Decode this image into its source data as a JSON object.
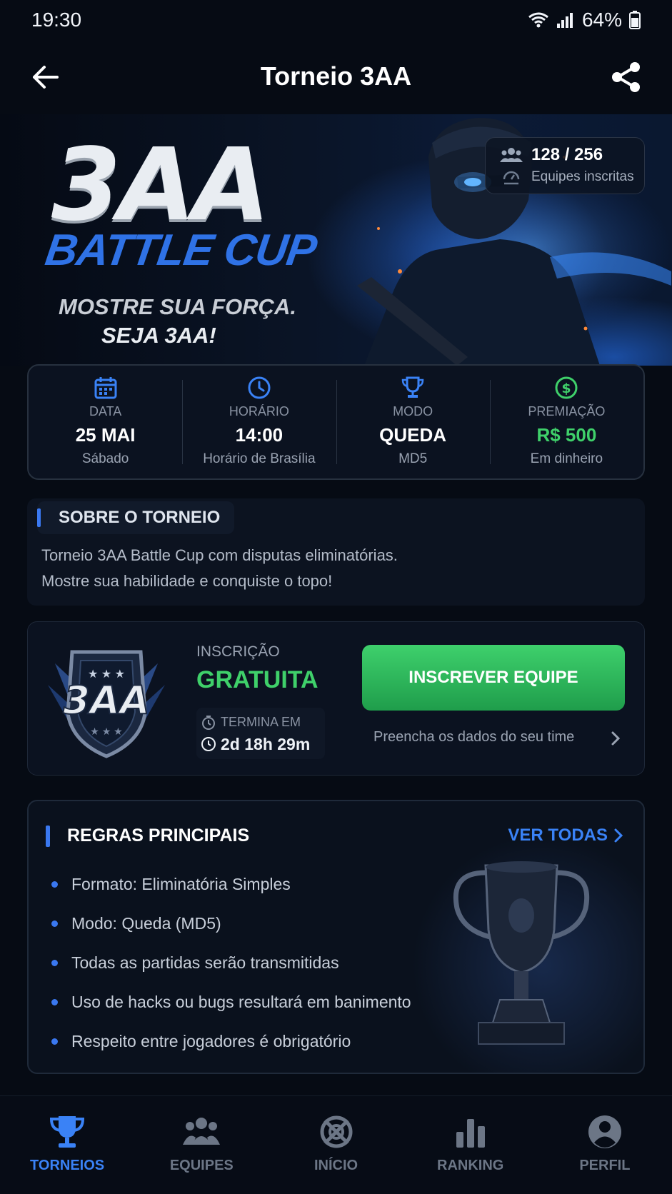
{
  "status_bar": {
    "time": "19:30",
    "battery": "64%"
  },
  "header": {
    "title": "Torneio 3AA"
  },
  "banner": {
    "logo": "3AA",
    "subtitle": "BATTLE CUP",
    "slogan_line1": "MOSTRE SUA FORÇA.",
    "slogan_line2": "SEJA 3AA!",
    "teams_count": "128 / 256",
    "teams_label": "Equipes inscritas"
  },
  "info": [
    {
      "label": "DATA",
      "value": "25 MAI",
      "sub": "Sábado"
    },
    {
      "label": "HORÁRIO",
      "value": "14:00",
      "sub": "Horário de Brasília"
    },
    {
      "label": "MODO",
      "value": "QUEDA",
      "sub": "MD5"
    },
    {
      "label": "PREMIAÇÃO",
      "value": "R$ 500",
      "sub": "Em dinheiro"
    }
  ],
  "about": {
    "title": "SOBRE O TORNEIO",
    "line1": "Torneio 3AA Battle Cup com disputas eliminatórias.",
    "line2": "Mostre sua habilidade e conquiste o topo!"
  },
  "registration": {
    "emblem_text": "3AA",
    "label": "INSCRIÇÃO",
    "value": "GRATUITA",
    "deadline_label": "TERMINA EM",
    "deadline_value": "2d 18h 29m",
    "cta_label": "INSCREVER EQUIPE",
    "cta_hint": "Preencha os dados do seu time"
  },
  "rules": {
    "title": "REGRAS PRINCIPAIS",
    "link": "VER TODAS",
    "items": [
      "Formato: Eliminatória Simples",
      "Modo: Queda (MD5)",
      "Todas as partidas serão transmitidas",
      "Uso de hacks ou bugs resultará em banimento",
      "Respeito entre jogadores é obrigatório"
    ]
  },
  "nav": [
    {
      "label": "TORNEIOS",
      "icon": "trophy-icon",
      "active": true
    },
    {
      "label": "EQUIPES",
      "icon": "users-icon"
    },
    {
      "label": "INÍCIO",
      "icon": "crosshair-icon"
    },
    {
      "label": "RANKING",
      "icon": "bar-chart-icon"
    },
    {
      "label": "PERFIL",
      "icon": "profile-icon"
    }
  ],
  "colors": {
    "accent": "#3a82f6",
    "success": "#3fd06a",
    "background": "#060b14"
  }
}
